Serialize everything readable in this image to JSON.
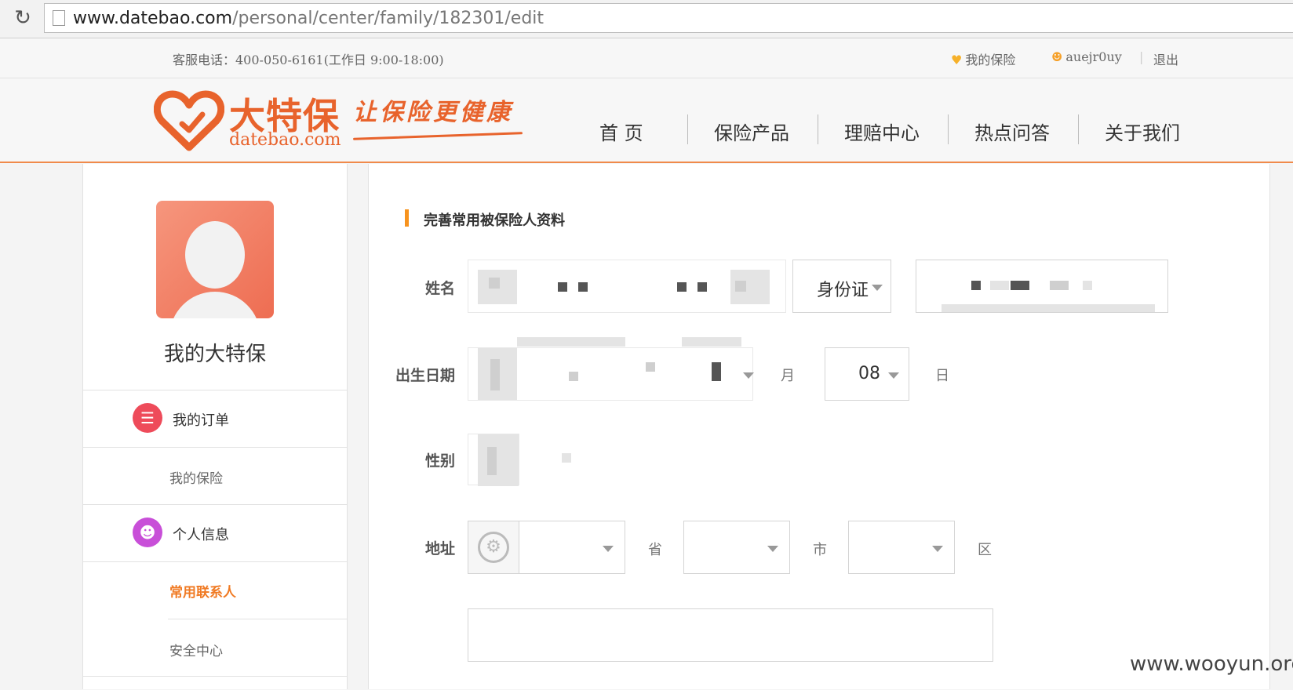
{
  "browser": {
    "url_host": "www.datebao.com",
    "url_path": "/personal/center/family/182301/edit"
  },
  "topbar": {
    "hotline": "客服电话：400-050-6161(工作日 9:00-18:00)",
    "my_insurance": "我的保险",
    "username": "auejr0uy",
    "separator": "|",
    "logout": "退出"
  },
  "brand": {
    "name": "大特保",
    "domain": "datebao.com",
    "slogan": "让保险更健康",
    "color": "#e8632c"
  },
  "nav": {
    "items": [
      "首 页",
      "保险产品",
      "理赔中心",
      "热点问答",
      "关于我们"
    ]
  },
  "sidebar": {
    "title": "我的大特保",
    "orders": "我的订单",
    "my_insurance": "我的保险",
    "personal_info": "个人信息",
    "contacts": "常用联系人",
    "security": "安全中心"
  },
  "form": {
    "section_title": "完善常用被保险人资料",
    "name_label": "姓名",
    "id_type": "身份证",
    "birth_label": "出生日期",
    "month_unit": "月",
    "day_value": "08",
    "day_unit": "日",
    "gender_label": "性别",
    "address_label": "地址",
    "province_unit": "省",
    "city_unit": "市",
    "district_unit": "区"
  },
  "watermark": "www.wooyun.org",
  "colors": {
    "accent": "#f07a23",
    "orders_icon": "#ee4b5a",
    "info_icon": "#c84fd8"
  }
}
